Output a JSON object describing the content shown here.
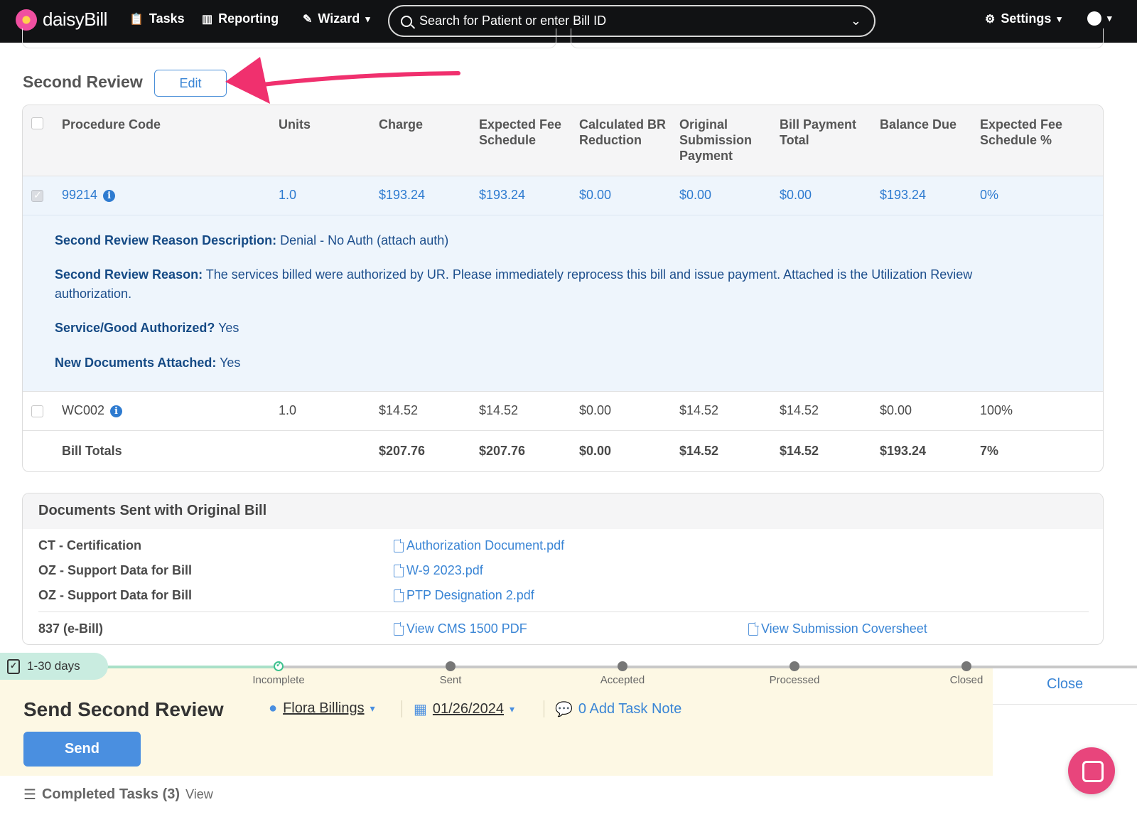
{
  "nav": {
    "brand": "daisyBill",
    "tasks": "Tasks",
    "reporting": "Reporting",
    "wizard": "Wizard",
    "search_placeholder": "Search for Patient or enter Bill ID",
    "settings": "Settings"
  },
  "second_review": {
    "title": "Second Review",
    "edit_label": "Edit"
  },
  "table": {
    "headers": [
      "Procedure Code",
      "Units",
      "Charge",
      "Expected Fee Schedule",
      "Calculated BR Reduction",
      "Original Submission Payment",
      "Bill Payment Total",
      "Balance Due",
      "Expected Fee Schedule %"
    ],
    "rows": [
      {
        "code": "99214",
        "units": "1.0",
        "charge": "$193.24",
        "expected": "$193.24",
        "br": "$0.00",
        "orig": "$0.00",
        "billpay": "$0.00",
        "balance": "$193.24",
        "pct": "0%",
        "checked": true
      },
      {
        "code": "WC002",
        "units": "1.0",
        "charge": "$14.52",
        "expected": "$14.52",
        "br": "$0.00",
        "orig": "$14.52",
        "billpay": "$14.52",
        "balance": "$0.00",
        "pct": "100%",
        "checked": false
      }
    ],
    "details": {
      "reason_desc_label": "Second Review Reason Description:",
      "reason_desc_value": "Denial - No Auth (attach auth)",
      "reason_label": "Second Review Reason:",
      "reason_value": "The services billed were authorized by UR. Please immediately reprocess this bill and issue payment. Attached is the Utilization Review authorization.",
      "authorized_label": "Service/Good Authorized?",
      "authorized_value": "Yes",
      "newdocs_label": "New Documents Attached:",
      "newdocs_value": "Yes"
    },
    "totals": {
      "label": "Bill Totals",
      "charge": "$207.76",
      "expected": "$207.76",
      "br": "$0.00",
      "orig": "$14.52",
      "billpay": "$14.52",
      "balance": "$193.24",
      "pct": "7%"
    }
  },
  "documents": {
    "title": "Documents Sent with Original Bill",
    "items": [
      {
        "label": "CT - Certification",
        "file": "Authorization Document.pdf"
      },
      {
        "label": "OZ - Support Data for Bill",
        "file": "W-9 2023.pdf"
      },
      {
        "label": "OZ - Support Data for Bill",
        "file": "PTP Designation 2.pdf"
      }
    ],
    "ebill_label": "837 (e-Bill)",
    "cms_link": "View CMS 1500 PDF",
    "coversheet_link": "View Submission Coversheet"
  },
  "task": {
    "days": "1-30 days",
    "stages": [
      "Incomplete",
      "Sent",
      "Accepted",
      "Processed",
      "Closed"
    ],
    "close": "Close",
    "title": "Send Second Review",
    "assignee": "Flora Billings",
    "date": "01/26/2024",
    "note": "0 Add Task Note",
    "send": "Send",
    "completed": "Completed Tasks (3)",
    "view": "View"
  },
  "colors": {
    "accent": "#2e7bd0",
    "arrow": "#f0306e",
    "task_bg": "#fdf8e4",
    "timeline_done": "#3ec28f"
  }
}
